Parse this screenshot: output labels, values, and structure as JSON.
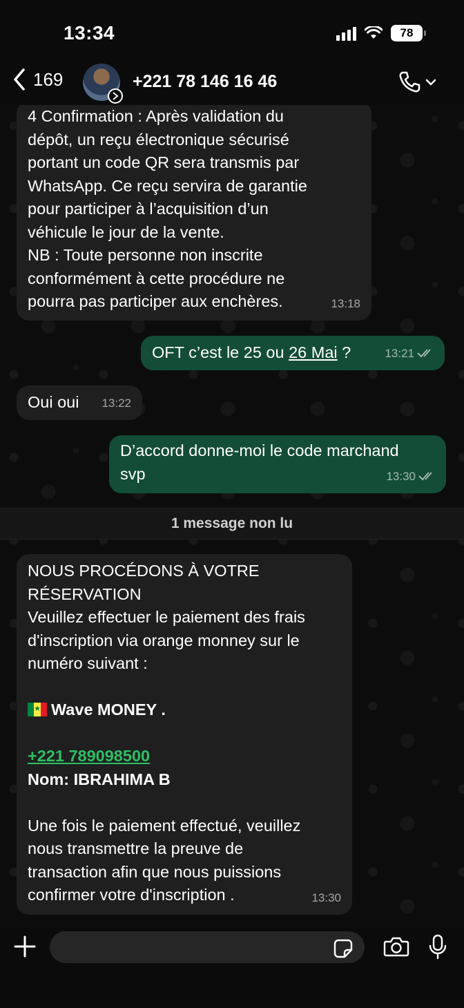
{
  "status_bar": {
    "time": "13:34",
    "battery": "78"
  },
  "header": {
    "back_count": "169",
    "contact_name": "+221 78 146 16 46"
  },
  "messages": {
    "m1": {
      "lines": [
        "4 Confirmation : Après validation du",
        "dépôt, un reçu électronique sécurisé",
        "portant un code QR sera transmis par",
        "WhatsApp. Ce reçu servira de garantie",
        "pour participer à l’acquisition d’un",
        "véhicule le jour de la vente.",
        "NB : Toute personne non inscrite",
        "conformément à cette procédure ne",
        "pourra pas participer aux enchères."
      ],
      "time": "13:18"
    },
    "m2": {
      "text_before": "OFT c’est le 25 ou ",
      "date_link": "26 Mai",
      "text_after": " ?",
      "time": "13:21"
    },
    "m3": {
      "text": "Oui oui",
      "time": "13:22"
    },
    "m4": {
      "lines": [
        "D’accord donne-moi le code marchand",
        "svp"
      ],
      "time": "13:30"
    },
    "m5": {
      "title_lines": [
        "NOUS PROCÉDONS À VOTRE",
        "RÉSERVATION"
      ],
      "body_lines": [
        "Veuillez effectuer le paiement des frais",
        "d'inscription via orange monney sur le",
        "numéro suivant :"
      ],
      "wave_label": "Wave MONEY .",
      "phone_link": "+221 789098500",
      "name_line": "Nom: IBRAHIMA B",
      "footer_lines": [
        "Une fois le paiement effectué, veuillez",
        "nous transmettre la preuve de",
        "transaction afin que nous puissions",
        "confirmer votre d'inscription ."
      ],
      "time": "13:30"
    }
  },
  "unread": {
    "label": "1 message non lu"
  },
  "input": {
    "placeholder": ""
  },
  "colors": {
    "outgoing_bubble": "#134d37",
    "incoming_bubble": "#1f1f1f",
    "link_green": "#2dbf64",
    "background": "#0b0b0b"
  }
}
